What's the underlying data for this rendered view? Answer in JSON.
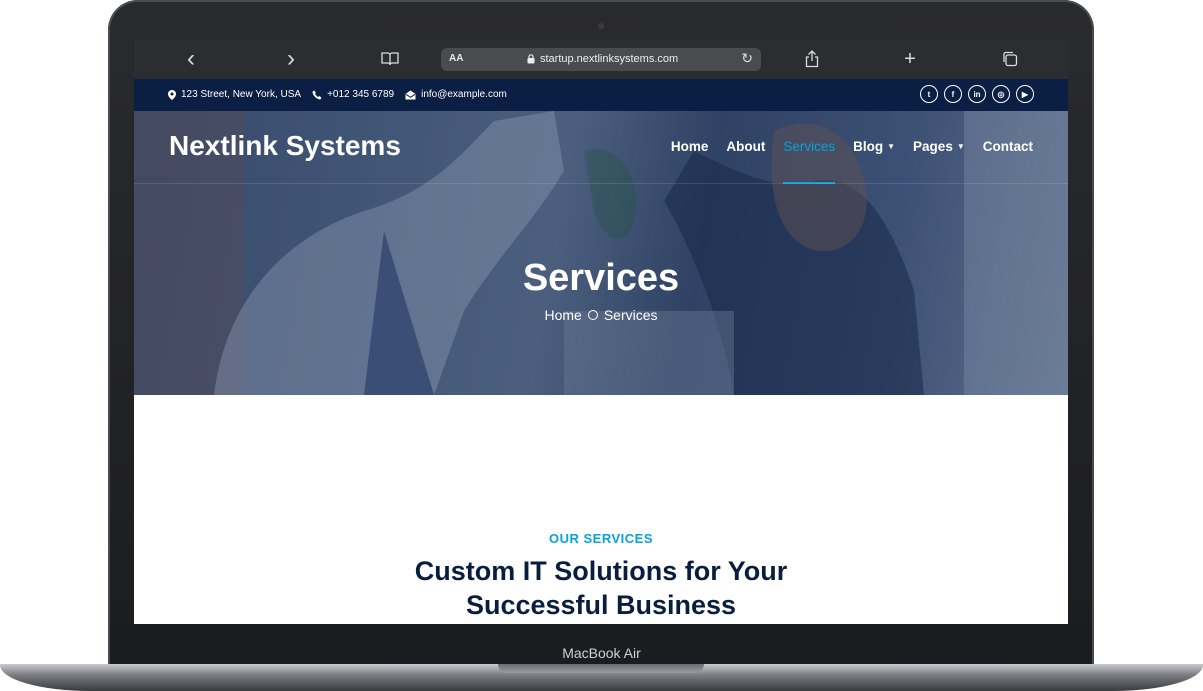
{
  "browser": {
    "back": "‹",
    "forward": "›",
    "aa": "AA",
    "url": "startup.nextlinksystems.com",
    "reload": "↻",
    "new_tab": "+"
  },
  "topbar": {
    "address": "123 Street, New York, USA",
    "phone": "+012 345 6789",
    "email": "info@example.com",
    "socials": [
      {
        "icon": "twitter-icon",
        "glyph": "t"
      },
      {
        "icon": "facebook-icon",
        "glyph": "f"
      },
      {
        "icon": "linkedin-icon",
        "glyph": "in"
      },
      {
        "icon": "instagram-icon",
        "glyph": "◎"
      },
      {
        "icon": "youtube-icon",
        "glyph": "▶"
      }
    ]
  },
  "nav": {
    "brand": "Nextlink Systems",
    "items": [
      "Home",
      "About",
      "Services",
      "Blog",
      "Pages",
      "Contact"
    ],
    "active": "Services"
  },
  "hero": {
    "title": "Services",
    "breadcrumb": [
      "Home",
      "Services"
    ]
  },
  "section": {
    "label": "OUR SERVICES",
    "heading": "Custom IT Solutions for Your Successful Business"
  },
  "device": {
    "model": "MacBook Air"
  },
  "colors": {
    "accent": "#06a3da",
    "dark": "#091e3e",
    "topbar": "#0b1f45"
  }
}
